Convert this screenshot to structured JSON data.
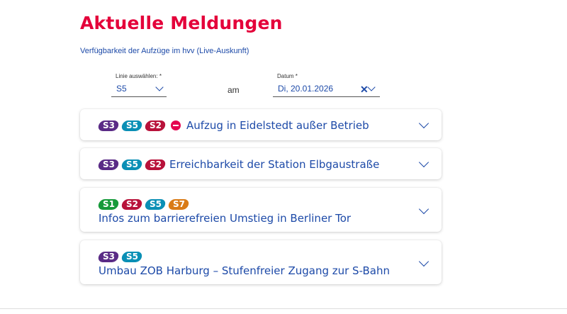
{
  "page": {
    "title": "Aktuelle Meldungen",
    "subtitle_link": "Verfügbarkeit der Aufzüge im hvv (Live-Auskunft)"
  },
  "filters": {
    "line_label": "Linie auswählen: *",
    "line_value": "S5",
    "connector": "am",
    "date_label": "Datum *",
    "date_value": "Di, 20.01.2026"
  },
  "colors": {
    "S1": "#169a3a",
    "S2": "#b8123a",
    "S3": "#5a2b86",
    "S5": "#0a8fb5",
    "S7": "#d97b16",
    "accent": "#e4003a",
    "link": "#1d4aa8"
  },
  "cards": [
    {
      "lines": [
        "S3",
        "S5",
        "S2"
      ],
      "icon": "no-entry-icon",
      "title": "Aufzug in Eidelstedt außer Betrieb"
    },
    {
      "lines": [
        "S3",
        "S5",
        "S2"
      ],
      "title": "Erreichbarkeit der Station Elbgaustraße"
    },
    {
      "lines": [
        "S1",
        "S2",
        "S5",
        "S7"
      ],
      "title": "Infos zum barrierefreien Umstieg in Berliner Tor"
    },
    {
      "lines": [
        "S3",
        "S5"
      ],
      "title": "Umbau ZOB Harburg – Stufenfreier Zugang zur S-Bahn"
    }
  ]
}
